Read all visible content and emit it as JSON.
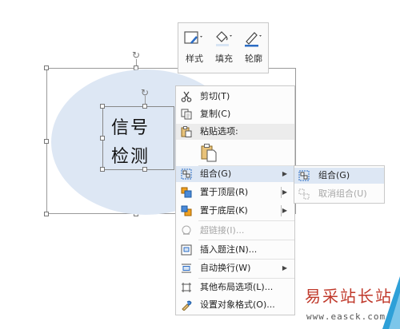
{
  "canvas": {
    "textbox": {
      "line1": "信号",
      "line2": "检测"
    }
  },
  "mini_toolbar": {
    "style_label": "样式",
    "fill_label": "填充",
    "outline_label": "轮廓"
  },
  "context_menu": {
    "items": [
      {
        "label": "剪切(T)",
        "icon": "scissors-icon"
      },
      {
        "label": "复制(C)",
        "icon": "copy-icon"
      },
      {
        "label": "粘贴选项:",
        "icon": "paste-icon"
      },
      {
        "label": "组合(G)",
        "icon": "group-icon"
      },
      {
        "label": "置于顶层(R)",
        "icon": "bring-to-front-icon"
      },
      {
        "label": "置于底层(K)",
        "icon": "send-to-back-icon"
      },
      {
        "label": "超链接(I)...",
        "icon": "hyperlink-icon"
      },
      {
        "label": "插入题注(N)...",
        "icon": "caption-icon"
      },
      {
        "label": "自动换行(W)",
        "icon": "wrap-text-icon"
      },
      {
        "label": "其他布局选项(L)...",
        "icon": "layout-options-icon"
      },
      {
        "label": "设置对象格式(O)...",
        "icon": "format-object-icon"
      }
    ]
  },
  "submenu": {
    "items": [
      {
        "label": "组合(G)",
        "icon": "group-icon"
      },
      {
        "label": "取消组合(U)",
        "icon": "ungroup-icon"
      }
    ]
  },
  "watermark": {
    "text": "易采站长站",
    "url": "www.easck.com"
  },
  "colors": {
    "ellipse_fill": "#dde7f4",
    "hover": "#dde7f4",
    "watermark_red": "#c0392b",
    "accent_blue": "#2b6cc4"
  }
}
